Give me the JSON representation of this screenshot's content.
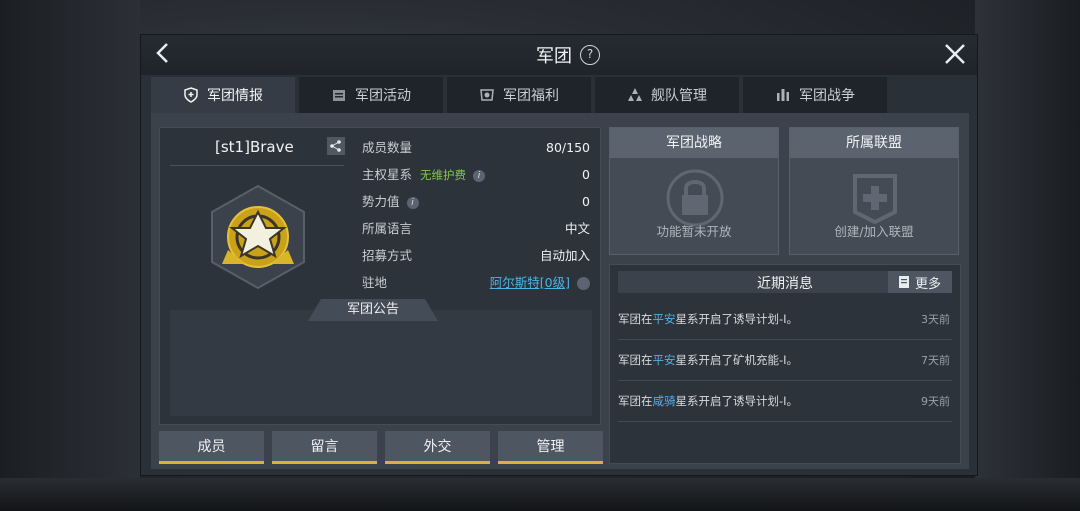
{
  "header": {
    "title": "军团",
    "help_glyph": "?"
  },
  "tabs": [
    {
      "label": "军团情报",
      "icon": "shield-icon",
      "active": true
    },
    {
      "label": "军团活动",
      "icon": "calendar-icon",
      "active": false
    },
    {
      "label": "军团福利",
      "icon": "gift-icon",
      "active": false
    },
    {
      "label": "舰队管理",
      "icon": "fleet-icon",
      "active": false
    },
    {
      "label": "军团战争",
      "icon": "war-icon",
      "active": false
    }
  ],
  "guild": {
    "name": "[st1]Brave",
    "info": {
      "members_label": "成员数量",
      "members_value": "80/150",
      "sovereign_label": "主权星系",
      "sovereign_note": "无维护费",
      "sovereign_value": "0",
      "power_label": "势力值",
      "power_value": "0",
      "language_label": "所属语言",
      "language_value": "中文",
      "recruit_label": "招募方式",
      "recruit_value": "自动加入",
      "base_label": "驻地",
      "base_value": "阿尔斯特[0级]"
    },
    "notice_label": "军团公告"
  },
  "buttons": {
    "members": "成员",
    "messages": "留言",
    "diplomacy": "外交",
    "manage": "管理"
  },
  "strategy": {
    "title": "军团战略",
    "caption": "功能暂未开放"
  },
  "alliance": {
    "title": "所属联盟",
    "caption": "创建/加入联盟"
  },
  "news": {
    "title": "近期消息",
    "more_label": "更多",
    "items": [
      {
        "prefix": "军团在",
        "system": "平安",
        "suffix": "星系开启了诱导计划-I。",
        "time": "3天前"
      },
      {
        "prefix": "军团在",
        "system": "平安",
        "suffix": "星系开启了矿机充能-I。",
        "time": "7天前"
      },
      {
        "prefix": "军团在",
        "system": "咸骑",
        "suffix": "星系开启了诱导计划-I。",
        "time": "9天前"
      }
    ]
  },
  "colors": {
    "accent_gold": "#d9b13b",
    "link_blue": "#4fb2e4",
    "note_green": "#7fc84a"
  }
}
